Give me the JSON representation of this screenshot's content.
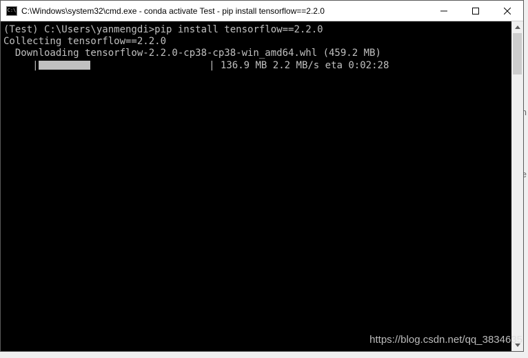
{
  "window": {
    "icon_text": "C:\\",
    "title": "C:\\Windows\\system32\\cmd.exe - conda  activate Test - pip  install tensorflow==2.2.0"
  },
  "console": {
    "prompt": "(Test) C:\\Users\\yanmengdi>",
    "command": "pip install tensorflow==2.2.0",
    "line_collecting": "Collecting tensorflow==2.2.0",
    "line_downloading": "  Downloading tensorflow-2.2.0-cp38-cp38-win_amd64.whl (459.2 MB)",
    "progress_prefix": "     |",
    "progress_suffix": "| 136.9 MB 2.2 MB/s eta 0:02:28",
    "progress_filled_chars": 10,
    "progress_total_chars": 33
  },
  "watermark": "https://blog.csdn.net/qq_3834635"
}
